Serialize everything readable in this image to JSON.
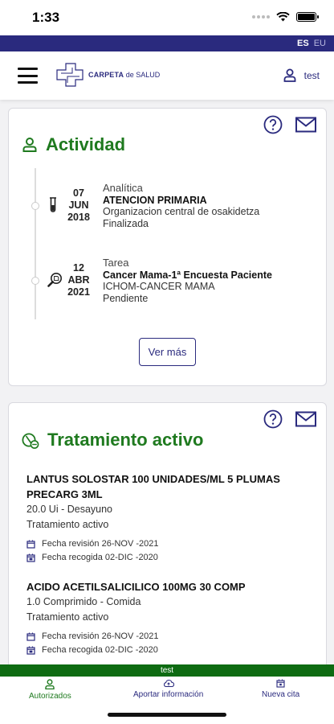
{
  "status_bar": {
    "time": "1:33"
  },
  "languages": {
    "active": "ES",
    "other": "EU"
  },
  "header": {
    "logo_bold": "CARPETA",
    "logo_rest": " de SALUD",
    "user_name": "test"
  },
  "activity": {
    "title": "Actividad",
    "items": [
      {
        "day": "07",
        "month": "JUN",
        "year": "2018",
        "type": "Analítica",
        "title": "ATENCION PRIMARIA",
        "line1": "Organizacion central de osakidetza",
        "line2": "Finalizada",
        "icon": "test-tube-icon"
      },
      {
        "day": "12",
        "month": "ABR",
        "year": "2021",
        "type": "Tarea",
        "title": "Cancer Mama-1ª Encuesta Paciente",
        "line1": "ICHOM-CANCER MAMA",
        "line2": "Pendiente",
        "icon": "search-document-icon"
      }
    ],
    "more_label": "Ver más"
  },
  "treatment": {
    "title": "Tratamiento activo",
    "items": [
      {
        "name": "LANTUS SOLOSTAR 100 UNIDADES/ML 5 PLUMAS PRECARG 3ML",
        "dose": "20.0 Ui - Desayuno",
        "status": "Tratamiento activo",
        "revision": "Fecha revisión 26-NOV -2021",
        "pickup": "Fecha recogida 02-DIC -2020"
      },
      {
        "name": "ACIDO ACETILSALICILICO 100MG 30 COMP",
        "dose": "1.0 Comprimido - Comida",
        "status": "Tratamiento activo",
        "revision": "Fecha revisión 26-NOV -2021",
        "pickup": "Fecha recogida 02-DIC -2020"
      }
    ]
  },
  "footer": {
    "user_strip": "test",
    "tabs": {
      "authorized": "Autorizados",
      "upload": "Aportar información",
      "appointment": "Nueva cita"
    }
  },
  "colors": {
    "navy": "#2a2a7e",
    "green": "#1f7a1f",
    "strip_green": "#0e6b12"
  }
}
